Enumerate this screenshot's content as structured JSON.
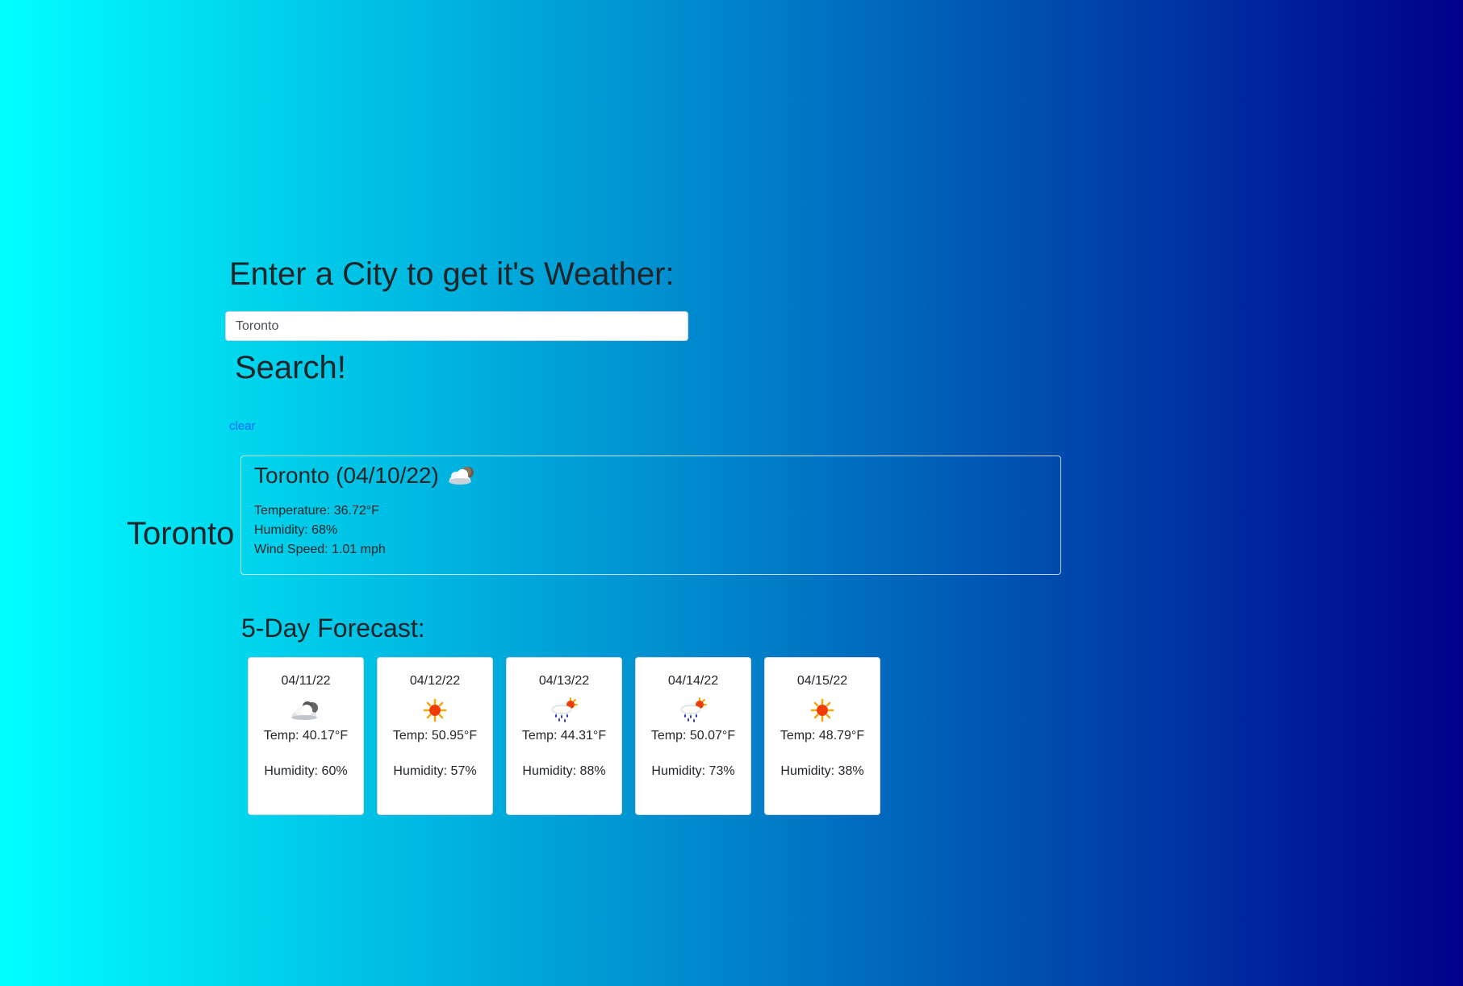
{
  "search": {
    "heading": "Enter a City to get it's Weather:",
    "input_value": "Toronto",
    "button_label": "Search!",
    "clear_label": "clear"
  },
  "history": [
    "Toronto"
  ],
  "current": {
    "title": "Toronto (04/10/22)",
    "icon": "cloudy-night-icon",
    "temperature": "Temperature: 36.72°F",
    "humidity": "Humidity: 68%",
    "wind": "Wind Speed: 1.01 mph"
  },
  "forecast": {
    "heading": "5-Day Forecast:",
    "days": [
      {
        "date": "04/11/22",
        "icon": "cloudy-icon",
        "temp": "Temp: 40.17°F",
        "humidity": "Humidity: 60%"
      },
      {
        "date": "04/12/22",
        "icon": "sun-icon",
        "temp": "Temp: 50.95°F",
        "humidity": "Humidity: 57%"
      },
      {
        "date": "04/13/22",
        "icon": "rain-sun-icon",
        "temp": "Temp: 44.31°F",
        "humidity": "Humidity: 88%"
      },
      {
        "date": "04/14/22",
        "icon": "rain-sun-icon",
        "temp": "Temp: 50.07°F",
        "humidity": "Humidity: 73%"
      },
      {
        "date": "04/15/22",
        "icon": "sun-icon",
        "temp": "Temp: 48.79°F",
        "humidity": "Humidity: 38%"
      }
    ]
  }
}
